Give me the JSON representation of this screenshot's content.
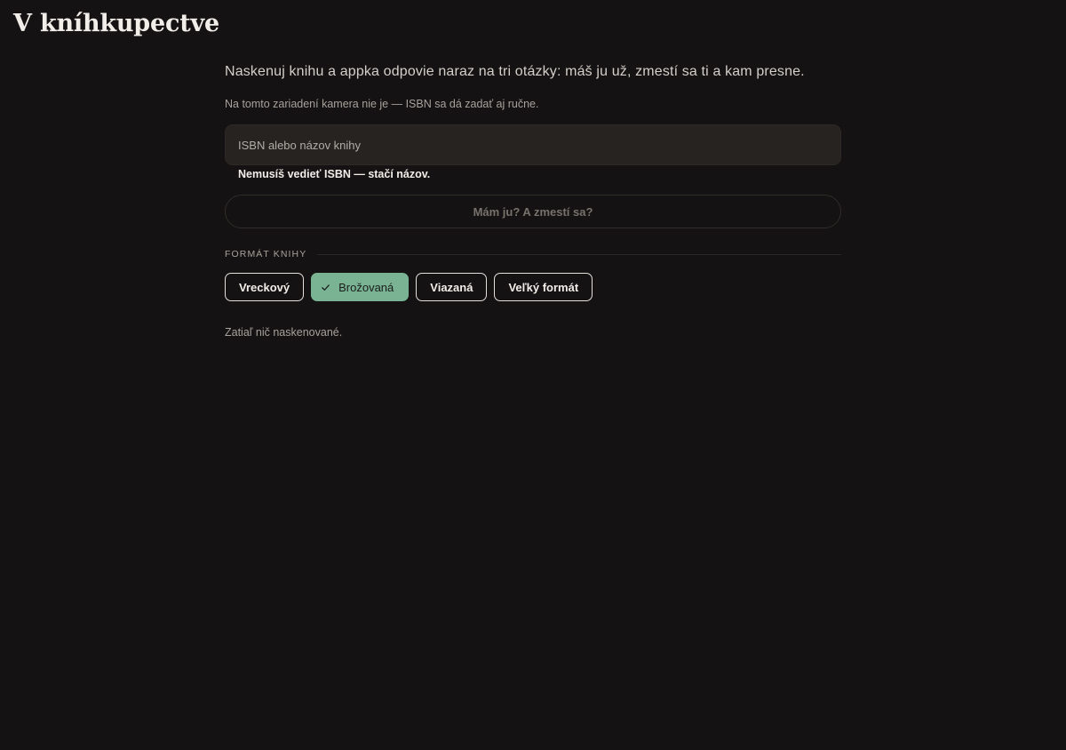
{
  "app": {
    "title": "V kníhkupectve"
  },
  "main": {
    "intro": "Naskenuj knihu a appka odpovie naraz na tri otázky: máš ju už, zmestí sa ti a kam presne.",
    "camera_note": "Na tomto zariadení kamera nie je — ISBN sa dá zadať aj ručne.",
    "search": {
      "placeholder": "ISBN alebo názov knihy",
      "value": ""
    },
    "search_hint": "Nemusíš vedieť ISBN — stačí názov.",
    "check_button_label": "Mám ju? A zmestí sa?",
    "format": {
      "label": "FORMÁT KNIHY",
      "options": [
        {
          "label": "Vreckový",
          "selected": false
        },
        {
          "label": "Brožovaná",
          "selected": true,
          "icon": "check-icon"
        },
        {
          "label": "Viazaná",
          "selected": false
        },
        {
          "label": "Veľký formát",
          "selected": false
        }
      ]
    },
    "empty_state": "Zatiaľ nič naskenované."
  },
  "colors": {
    "background": "#141212",
    "input_background": "#262321",
    "accent_selected": "#79b394",
    "text_primary": "#f1eee9",
    "text_muted": "#a7a29c"
  }
}
